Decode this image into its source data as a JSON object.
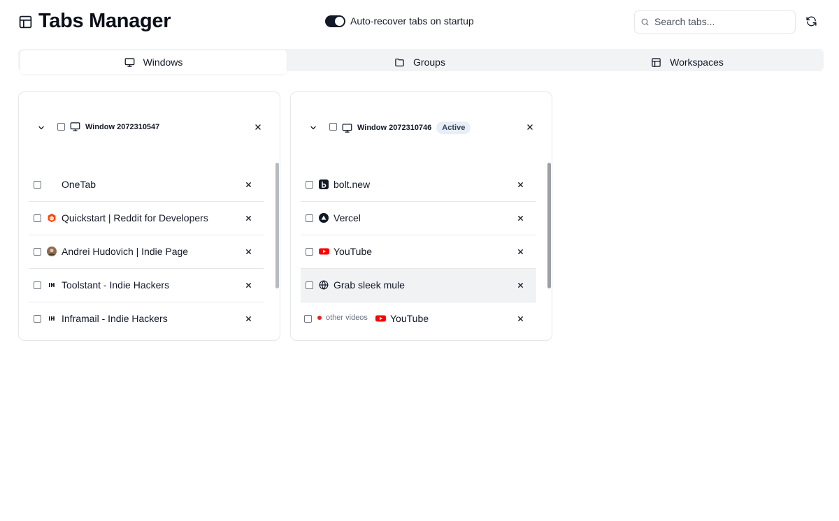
{
  "app": {
    "title": "Tabs Manager"
  },
  "header": {
    "auto_recover_label": "Auto-recover tabs on startup",
    "auto_recover_on": true,
    "search_placeholder": "Search tabs...",
    "search_value": ""
  },
  "view_tabs": [
    {
      "label": "Windows",
      "icon": "monitor-icon",
      "active": true
    },
    {
      "label": "Groups",
      "icon": "folder-icon",
      "active": false
    },
    {
      "label": "Workspaces",
      "icon": "layout-icon",
      "active": false
    }
  ],
  "windows": [
    {
      "title": "Window 2072310547",
      "badge": "",
      "tabs": [
        {
          "title": "OneTab",
          "favicon": "none"
        },
        {
          "title": "Quickstart | Reddit for Developers",
          "favicon": "reddit-icon"
        },
        {
          "title": "Andrei Hudovich | Indie Page",
          "favicon": "avatar-icon"
        },
        {
          "title": "Toolstant - Indie Hackers",
          "favicon": "indie-hackers-icon"
        },
        {
          "title": "Inframail - Indie Hackers",
          "favicon": "indie-hackers-icon"
        }
      ]
    },
    {
      "title": "Window 2072310746",
      "badge": "Active",
      "tabs": [
        {
          "title": "bolt.new",
          "favicon": "bolt-icon"
        },
        {
          "title": "Vercel",
          "favicon": "vercel-icon"
        },
        {
          "title": "YouTube",
          "favicon": "youtube-icon"
        },
        {
          "title": "Grab sleek mule",
          "favicon": "globe-icon",
          "highlighted": true
        },
        {
          "title": "YouTube",
          "favicon": "youtube-icon",
          "group": "other videos",
          "group_color": "#dc2626"
        }
      ]
    }
  ],
  "colors": {
    "accent": "#111827",
    "youtube": "#ff0000",
    "reddit": "#ff4500",
    "badge_bg": "#e8eef8"
  }
}
